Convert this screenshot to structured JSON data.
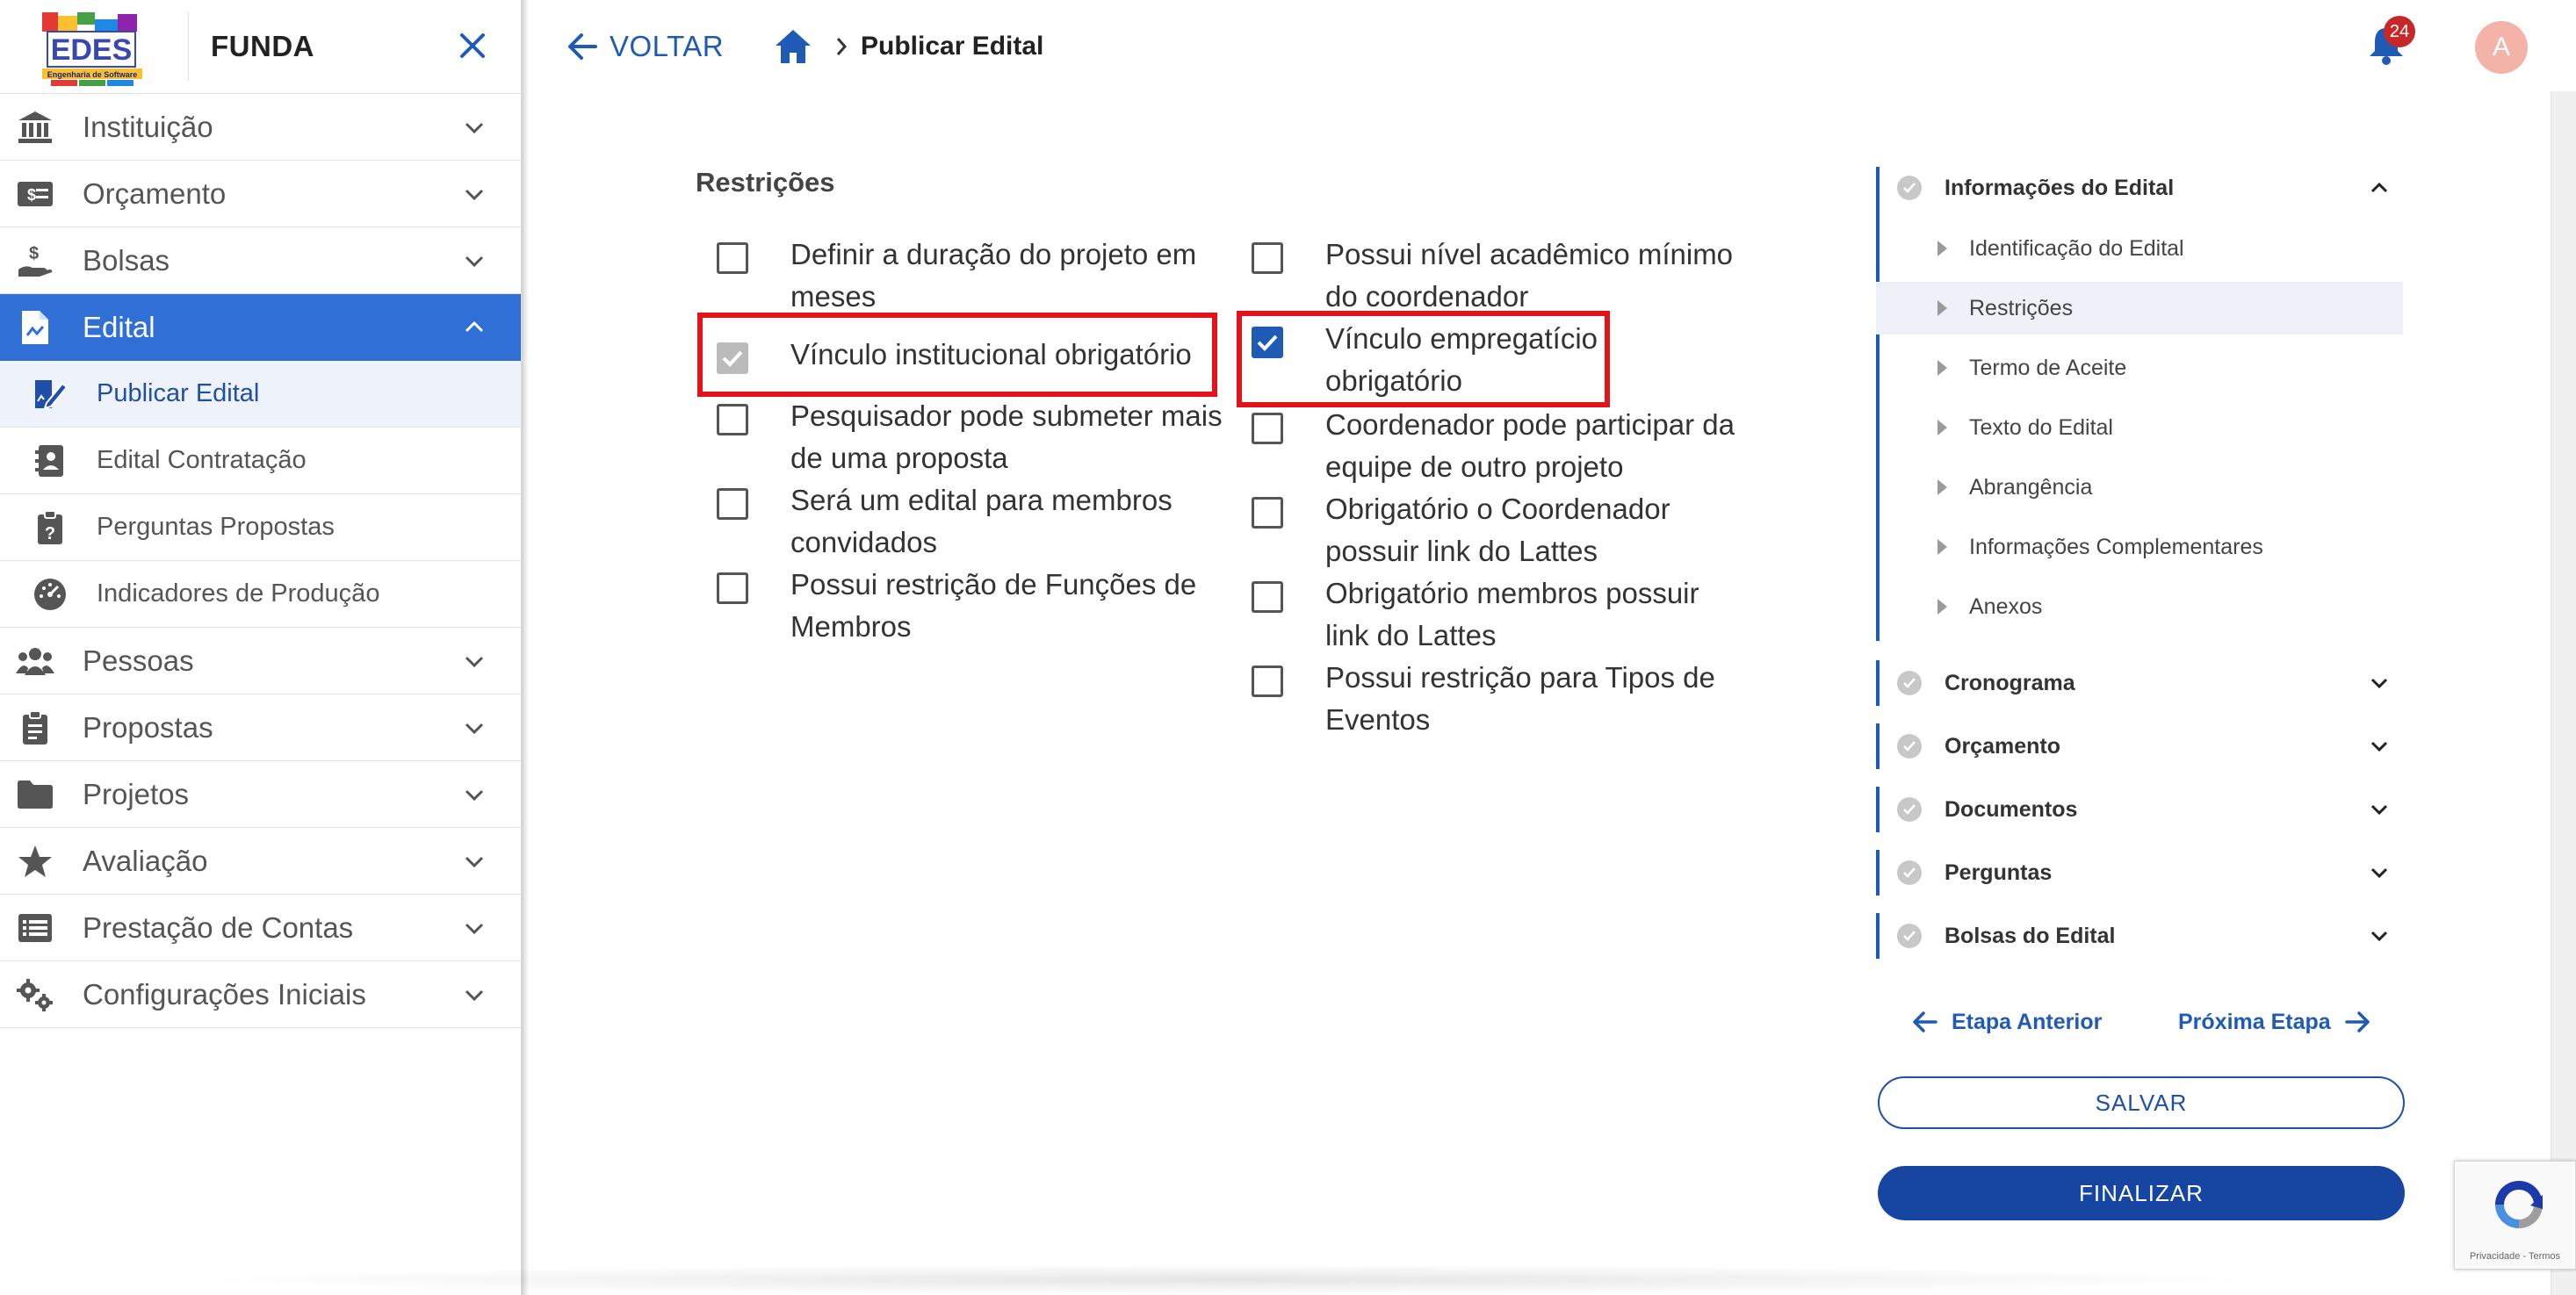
{
  "sidebar": {
    "org_name": "FUNDA",
    "logo_text": "EDES",
    "logo_subtext": "Engenharia de Software",
    "items": [
      {
        "label": "Instituição",
        "icon": "institution-icon"
      },
      {
        "label": "Orçamento",
        "icon": "money-icon"
      },
      {
        "label": "Bolsas",
        "icon": "hand-coin-icon"
      },
      {
        "label": "Edital",
        "icon": "document-icon",
        "expanded": true
      },
      {
        "label": "Pessoas",
        "icon": "people-icon"
      },
      {
        "label": "Propostas",
        "icon": "proposal-icon"
      },
      {
        "label": "Projetos",
        "icon": "folder-icon"
      },
      {
        "label": "Avaliação",
        "icon": "star-icon"
      },
      {
        "label": "Prestação de Contas",
        "icon": "list-icon"
      },
      {
        "label": "Configurações Iniciais",
        "icon": "gears-icon"
      }
    ],
    "sub_items": [
      {
        "label": "Publicar Edital",
        "icon": "edit-document-icon",
        "active": true
      },
      {
        "label": "Edital Contratação",
        "icon": "contact-card-icon"
      },
      {
        "label": "Perguntas Propostas",
        "icon": "question-clipboard-icon"
      },
      {
        "label": "Indicadores de Produção",
        "icon": "gauge-icon"
      }
    ]
  },
  "topbar": {
    "back_label": "VOLTAR",
    "breadcrumb_current": "Publicar Edital",
    "notification_count": "24",
    "avatar_initial": "A"
  },
  "restricoes": {
    "title": "Restrições",
    "left": [
      {
        "label": "Definir a duração do projeto em meses",
        "state": "unchecked"
      },
      {
        "label": "Vínculo institucional obrigatório",
        "state": "disabled-checked"
      },
      {
        "label": "Pesquisador pode submeter mais de uma proposta",
        "state": "unchecked"
      },
      {
        "label": "Será um edital para membros convidados",
        "state": "unchecked"
      },
      {
        "label": "Possui restrição de Funções de Membros",
        "state": "unchecked"
      }
    ],
    "right": [
      {
        "label": "Possui nível acadêmico mínimo do coordenador",
        "state": "unchecked"
      },
      {
        "label": "Vínculo empregatício obrigatório",
        "state": "checked"
      },
      {
        "label": "Coordenador pode participar da equipe de outro projeto",
        "state": "unchecked"
      },
      {
        "label": "Obrigatório o Coordenador possuir link do Lattes",
        "state": "unchecked"
      },
      {
        "label": "Obrigatório membros possuir link do Lattes",
        "state": "unchecked"
      },
      {
        "label": "Possui restrição para Tipos de Eventos",
        "state": "unchecked"
      }
    ]
  },
  "stepper": {
    "steps": [
      {
        "label": "Informações do Edital",
        "expanded": true
      },
      {
        "label": "Cronograma"
      },
      {
        "label": "Orçamento"
      },
      {
        "label": "Documentos"
      },
      {
        "label": "Perguntas"
      },
      {
        "label": "Bolsas do Edital"
      }
    ],
    "sub_steps": [
      {
        "label": "Identificação do Edital"
      },
      {
        "label": "Restrições",
        "active": true
      },
      {
        "label": "Termo de Aceite"
      },
      {
        "label": "Texto do Edital"
      },
      {
        "label": "Abrangência"
      },
      {
        "label": "Informações Complementares"
      },
      {
        "label": "Anexos"
      }
    ],
    "prev_label": "Etapa Anterior",
    "next_label": "Próxima Etapa",
    "save_label": "SALVAR",
    "finish_label": "FINALIZAR"
  },
  "recaptcha": {
    "text": "Privacidade - Termos"
  },
  "colors": {
    "primary": "#1f5bb5",
    "active_menu": "#2f6fd6",
    "highlight": "#e4121b",
    "badge": "#c62828"
  }
}
